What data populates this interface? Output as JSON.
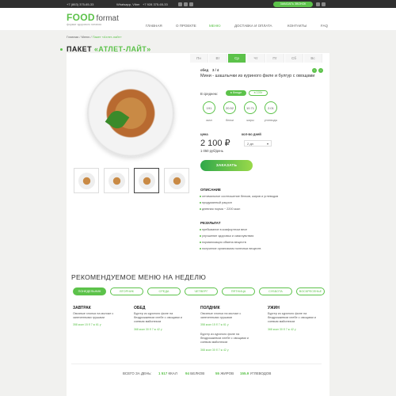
{
  "topbar": {
    "phone1": "+7 (863) 375-65-33",
    "messengers": "Whatsapp, Viber",
    "phone2": "+7 928 375-65-33",
    "callback": "ЗАКАЗАТЬ ЗВОНОК"
  },
  "header": {
    "logo_food": "FOOD",
    "logo_format": "format",
    "logo_sub": "формат здорового питания",
    "nav": [
      "ГЛАВНАЯ",
      "О ПРОЕКТЕ",
      "МЕНЮ",
      "ДОСТАВКА И ОПЛАТА",
      "КОНТАКТЫ",
      "FAQ"
    ]
  },
  "breadcrumb": [
    "Главная",
    "Меню",
    "Пакет «Атлет-лайт»"
  ],
  "page_title": {
    "prefix": "ПАКЕТ",
    "name": "«АТЛЕТ-ЛАЙТ»"
  },
  "days": [
    "Пн",
    "Вт",
    "Ср",
    "Чт",
    "Пт",
    "Сб",
    "Вс"
  ],
  "active_day": 2,
  "dish": {
    "meal_label": "обед",
    "counter": "3 / 4",
    "name": "Мини - шашлычки из куриного филе и булгур с овощами",
    "avg_label": "В среднем:",
    "pill1": "в блюде",
    "pill2": "в 100г",
    "nutrients": [
      {
        "value": "191",
        "label": "ккал"
      },
      {
        "value": "20.52",
        "label": "белки"
      },
      {
        "value": "10.71",
        "label": "жиры"
      },
      {
        "value": "2.01",
        "label": "углеводы"
      }
    ]
  },
  "price": {
    "price_label": "цена",
    "days_label": "кол-во дней",
    "value": "2 100 ₽",
    "per_day": "1 050 руб/день",
    "select_value": "2 дн"
  },
  "buy_label": "ЗАКАЗАТЬ",
  "description": {
    "title": "ОПИСАНИЕ",
    "items": [
      "оптимальное соотношение белков, жиров и углеводов",
      "продуманный рацион",
      "дневная норма ~ 2200 ккал"
    ]
  },
  "result": {
    "title": "РЕЗУЛЬТАТ",
    "items": [
      "пребывание в комфортном весе",
      "улучшение здоровья и самочувствия",
      "нормализация обмена веществ",
      "получение организмом полезных веществ"
    ]
  },
  "recommended": {
    "title": "РЕКОМЕНДУЕМОЕ МЕНЮ НА НЕДЕЛЮ",
    "tabs": [
      "ПОНЕДЕЛЬНИК",
      "ВТОРНИК",
      "СРЕДА",
      "ЧЕТВЕРГ",
      "ПЯТНИЦА",
      "СУББОТА",
      "ВОСКРЕСЕНЬЕ"
    ],
    "meals": [
      {
        "title": "ЗАВТРАК",
        "text": "Овсяные хлопья на молоке с запеченными грушами",
        "nums": "358 ккал   15 б   7 ж   61 у"
      },
      {
        "title": "ОБЕД",
        "text": "Бургер из куриного филе на бездрожжевом хлебе с овощами и соевым майонезом",
        "nums": "368 ккал   30 б   7 ж   42 у"
      },
      {
        "title": "ПОЛДНИК",
        "text": "Овсяные хлопья на молоке с запеченными грушами",
        "nums": "358 ккал   15 б   7 ж   61 у",
        "text2": "Бургер из куриного филе на бездрожжевом хлебе с овощами и соевым майонезом",
        "nums2": "368 ккал   30 б   7 ж   42 у"
      },
      {
        "title": "УЖИН",
        "text": "Бургер из куриного филе на бездрожжевом хлебе с овощами и соевым майонезом",
        "nums": "368 ккал   30 б   7 ж   42 у"
      }
    ]
  },
  "totals": {
    "label": "ВСЕГО ЗА ДЕНЬ:",
    "kcal": "1 517",
    "kcal_l": "ККАЛ",
    "protein": "94",
    "protein_l": "БЕЛКОВ",
    "fat": "55",
    "fat_l": "ЖИРОВ",
    "carbs": "155.9",
    "carbs_l": "УГЛЕВОДОВ"
  },
  "colors": {
    "accent": "#5cc24a",
    "dark": "#2f2f2f"
  }
}
